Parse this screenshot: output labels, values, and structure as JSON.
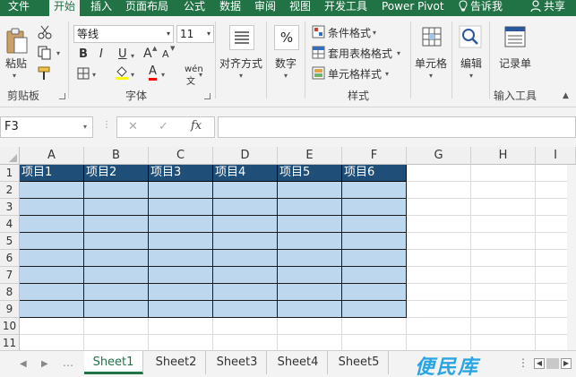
{
  "ribbon_tabs": [
    "文件",
    "开始",
    "插入",
    "页面布局",
    "公式",
    "数据",
    "审阅",
    "视图",
    "开发工具",
    "Power Pivot",
    "告诉我",
    "共享"
  ],
  "ribbon": {
    "clipboard": {
      "paste_label": "粘贴",
      "group_label": "剪贴板"
    },
    "font": {
      "font_name": "等线",
      "font_size": "11",
      "group_label": "字体",
      "bold": "B",
      "italic": "I",
      "underline": "U",
      "grow": "A",
      "shrink": "A",
      "font_color": "A",
      "phonetic": "wén"
    },
    "alignment": {
      "label": "对齐方式"
    },
    "number": {
      "label": "数字",
      "symbol": "%"
    },
    "styles": {
      "conditional": "条件格式",
      "table_format": "套用表格格式",
      "cell_styles": "单元格样式",
      "group_label": "样式"
    },
    "cells": {
      "label": "单元格"
    },
    "editing": {
      "label": "编辑"
    },
    "record": {
      "label": "记录单",
      "group_label": "输入工具"
    }
  },
  "formula_bar": {
    "name_box": "F3",
    "fx": "fx",
    "cancel": "✕",
    "confirm": "✓",
    "formula_value": ""
  },
  "grid": {
    "columns": [
      "A",
      "B",
      "C",
      "D",
      "E",
      "F",
      "G",
      "H",
      "I"
    ],
    "rows": [
      "1",
      "2",
      "3",
      "4",
      "5",
      "6",
      "7",
      "8",
      "9",
      "10",
      "11"
    ],
    "header_row": [
      "项目1",
      "项目2",
      "项目3",
      "项目4",
      "项目5",
      "项目6"
    ],
    "table_header_color": "#1f4e78",
    "table_body_color": "#bdd7ee"
  },
  "sheets": [
    "Sheet1",
    "Sheet2",
    "Sheet3",
    "Sheet4",
    "Sheet5"
  ],
  "active_sheet": "Sheet1",
  "watermark": "便民库",
  "colors": {
    "excel_green": "#217346",
    "ribbon_bg": "#f3f3f3"
  }
}
